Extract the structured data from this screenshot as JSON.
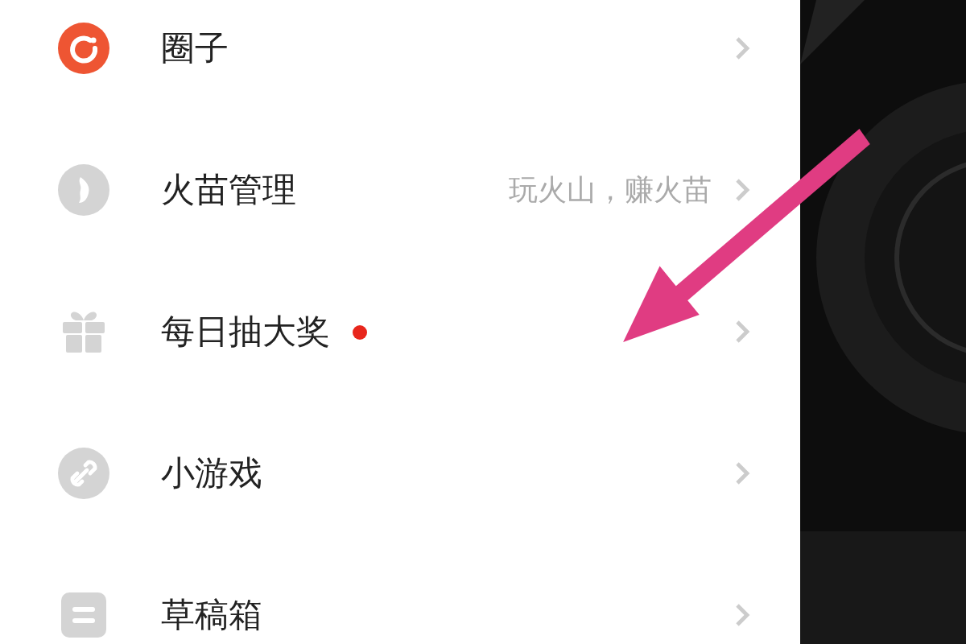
{
  "menu": {
    "items": [
      {
        "kind": "ring",
        "label": "圈子",
        "new_dot": false
      },
      {
        "kind": "flame",
        "label": "火苗管理",
        "subtitle": "玩火山，赚火苗",
        "new_dot": false
      },
      {
        "kind": "gift",
        "label": "每日抽大奖",
        "new_dot": true
      },
      {
        "kind": "link",
        "label": "小游戏",
        "new_dot": false
      },
      {
        "kind": "draft",
        "label": "草稿箱",
        "new_dot": false
      }
    ]
  }
}
